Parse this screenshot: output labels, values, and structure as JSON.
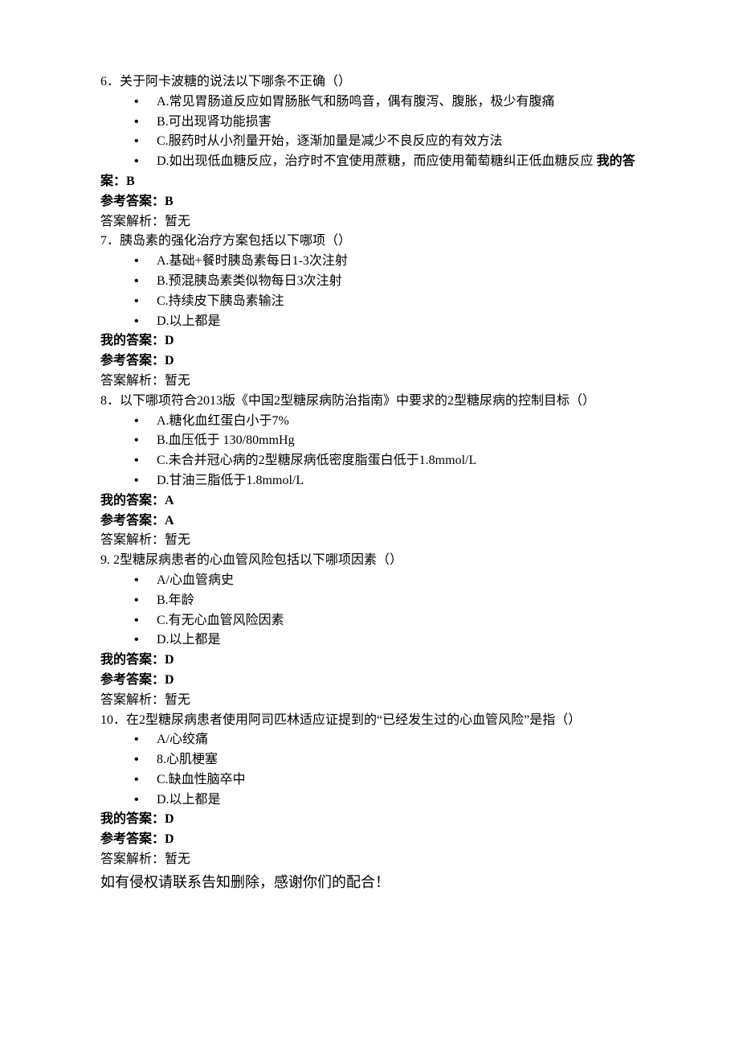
{
  "questions": [
    {
      "stem": "6．关于阿卡波糖的说法以下哪条不正确（）",
      "options": [
        "A.常见胃肠道反应如胃肠胀气和肠鸣音，偶有腹泻、腹胀，极少有腹痛",
        "B.可出现肾功能损害",
        "C.服药时从小剂量开始，逐渐加量是减少不良反应的有效方法",
        "D.如出现低血糖反应，治疗时不宜使用蔗糖，而应使用葡萄糖纠正低血糖反应"
      ],
      "my_ans_inline_label": "我的答",
      "my_ans_wrap": "案：B",
      "ref_ans": "参考答案：B",
      "analysis": "答案解析：暂无"
    },
    {
      "stem": "7．胰岛素的强化治疗方案包括以下哪项（）",
      "options": [
        "A.基础+餐时胰岛素每日1-3次注射",
        "B.预混胰岛素类似物每日3次注射",
        "C.持续皮下胰岛素输注",
        "D.以上都是"
      ],
      "my_ans": "我的答案：D",
      "ref_ans": "参考答案：D",
      "analysis": "答案解析：暂无"
    },
    {
      "stem": "8．以下哪项符合2013版《中国2型糖尿病防治指南》中要求的2型糖尿病的控制目标（）",
      "options": [
        "A.糖化血红蛋白小于7%",
        "B.血压低于 130/80mmHg",
        "C.未合并冠心病的2型糖尿病低密度脂蛋白低于1.8mmol/L",
        "D.甘油三脂低于1.8mmol/L"
      ],
      "my_ans": "我的答案：A",
      "ref_ans": "参考答案：A",
      "analysis": "答案解析：暂无"
    },
    {
      "stem": "9. 2型糖尿病患者的心血管风险包括以下哪项因素（）",
      "options": [
        "A/心血管病史",
        "B.年龄",
        "C.有无心血管风险因素",
        "D.以上都是"
      ],
      "my_ans": "我的答案：D",
      "ref_ans": "参考答案：D",
      "analysis": "答案解析：暂无"
    },
    {
      "stem": "10．在2型糖尿病患者使用阿司匹林适应证提到的“已经发生过的心血管风险”是指（）",
      "options": [
        "A/心绞痛",
        "8.心肌梗塞",
        "C.缺血性脑卒中",
        "D.以上都是"
      ],
      "my_ans": "我的答案：D",
      "ref_ans": "参考答案：D",
      "analysis": "答案解析：暂无"
    }
  ],
  "footer": "如有侵权请联系告知删除，感谢你们的配合！",
  "bullet": "•"
}
